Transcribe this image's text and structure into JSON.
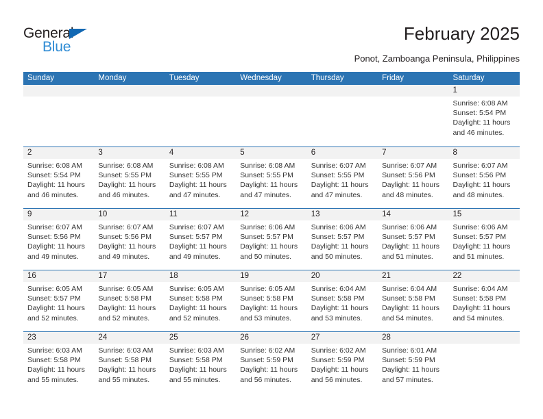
{
  "brand": {
    "name_top": "General",
    "name_bottom": "Blue",
    "accent_color": "#2e8bd4",
    "triangle_color": "#1268b3"
  },
  "header": {
    "title": "February 2025",
    "location": "Ponot, Zamboanga Peninsula, Philippines"
  },
  "theme": {
    "header_blue": "#2c74b3",
    "day_band_gray": "#f2f2f2",
    "text_color": "#231f20"
  },
  "weekdays": [
    "Sunday",
    "Monday",
    "Tuesday",
    "Wednesday",
    "Thursday",
    "Friday",
    "Saturday"
  ],
  "weeks": [
    [
      {
        "day": "",
        "sunrise": "",
        "sunset": "",
        "daylight_1": "",
        "daylight_2": ""
      },
      {
        "day": "",
        "sunrise": "",
        "sunset": "",
        "daylight_1": "",
        "daylight_2": ""
      },
      {
        "day": "",
        "sunrise": "",
        "sunset": "",
        "daylight_1": "",
        "daylight_2": ""
      },
      {
        "day": "",
        "sunrise": "",
        "sunset": "",
        "daylight_1": "",
        "daylight_2": ""
      },
      {
        "day": "",
        "sunrise": "",
        "sunset": "",
        "daylight_1": "",
        "daylight_2": ""
      },
      {
        "day": "",
        "sunrise": "",
        "sunset": "",
        "daylight_1": "",
        "daylight_2": ""
      },
      {
        "day": "1",
        "sunrise": "Sunrise: 6:08 AM",
        "sunset": "Sunset: 5:54 PM",
        "daylight_1": "Daylight: 11 hours",
        "daylight_2": "and 46 minutes."
      }
    ],
    [
      {
        "day": "2",
        "sunrise": "Sunrise: 6:08 AM",
        "sunset": "Sunset: 5:54 PM",
        "daylight_1": "Daylight: 11 hours",
        "daylight_2": "and 46 minutes."
      },
      {
        "day": "3",
        "sunrise": "Sunrise: 6:08 AM",
        "sunset": "Sunset: 5:55 PM",
        "daylight_1": "Daylight: 11 hours",
        "daylight_2": "and 46 minutes."
      },
      {
        "day": "4",
        "sunrise": "Sunrise: 6:08 AM",
        "sunset": "Sunset: 5:55 PM",
        "daylight_1": "Daylight: 11 hours",
        "daylight_2": "and 47 minutes."
      },
      {
        "day": "5",
        "sunrise": "Sunrise: 6:08 AM",
        "sunset": "Sunset: 5:55 PM",
        "daylight_1": "Daylight: 11 hours",
        "daylight_2": "and 47 minutes."
      },
      {
        "day": "6",
        "sunrise": "Sunrise: 6:07 AM",
        "sunset": "Sunset: 5:55 PM",
        "daylight_1": "Daylight: 11 hours",
        "daylight_2": "and 47 minutes."
      },
      {
        "day": "7",
        "sunrise": "Sunrise: 6:07 AM",
        "sunset": "Sunset: 5:56 PM",
        "daylight_1": "Daylight: 11 hours",
        "daylight_2": "and 48 minutes."
      },
      {
        "day": "8",
        "sunrise": "Sunrise: 6:07 AM",
        "sunset": "Sunset: 5:56 PM",
        "daylight_1": "Daylight: 11 hours",
        "daylight_2": "and 48 minutes."
      }
    ],
    [
      {
        "day": "9",
        "sunrise": "Sunrise: 6:07 AM",
        "sunset": "Sunset: 5:56 PM",
        "daylight_1": "Daylight: 11 hours",
        "daylight_2": "and 49 minutes."
      },
      {
        "day": "10",
        "sunrise": "Sunrise: 6:07 AM",
        "sunset": "Sunset: 5:56 PM",
        "daylight_1": "Daylight: 11 hours",
        "daylight_2": "and 49 minutes."
      },
      {
        "day": "11",
        "sunrise": "Sunrise: 6:07 AM",
        "sunset": "Sunset: 5:57 PM",
        "daylight_1": "Daylight: 11 hours",
        "daylight_2": "and 49 minutes."
      },
      {
        "day": "12",
        "sunrise": "Sunrise: 6:06 AM",
        "sunset": "Sunset: 5:57 PM",
        "daylight_1": "Daylight: 11 hours",
        "daylight_2": "and 50 minutes."
      },
      {
        "day": "13",
        "sunrise": "Sunrise: 6:06 AM",
        "sunset": "Sunset: 5:57 PM",
        "daylight_1": "Daylight: 11 hours",
        "daylight_2": "and 50 minutes."
      },
      {
        "day": "14",
        "sunrise": "Sunrise: 6:06 AM",
        "sunset": "Sunset: 5:57 PM",
        "daylight_1": "Daylight: 11 hours",
        "daylight_2": "and 51 minutes."
      },
      {
        "day": "15",
        "sunrise": "Sunrise: 6:06 AM",
        "sunset": "Sunset: 5:57 PM",
        "daylight_1": "Daylight: 11 hours",
        "daylight_2": "and 51 minutes."
      }
    ],
    [
      {
        "day": "16",
        "sunrise": "Sunrise: 6:05 AM",
        "sunset": "Sunset: 5:57 PM",
        "daylight_1": "Daylight: 11 hours",
        "daylight_2": "and 52 minutes."
      },
      {
        "day": "17",
        "sunrise": "Sunrise: 6:05 AM",
        "sunset": "Sunset: 5:58 PM",
        "daylight_1": "Daylight: 11 hours",
        "daylight_2": "and 52 minutes."
      },
      {
        "day": "18",
        "sunrise": "Sunrise: 6:05 AM",
        "sunset": "Sunset: 5:58 PM",
        "daylight_1": "Daylight: 11 hours",
        "daylight_2": "and 52 minutes."
      },
      {
        "day": "19",
        "sunrise": "Sunrise: 6:05 AM",
        "sunset": "Sunset: 5:58 PM",
        "daylight_1": "Daylight: 11 hours",
        "daylight_2": "and 53 minutes."
      },
      {
        "day": "20",
        "sunrise": "Sunrise: 6:04 AM",
        "sunset": "Sunset: 5:58 PM",
        "daylight_1": "Daylight: 11 hours",
        "daylight_2": "and 53 minutes."
      },
      {
        "day": "21",
        "sunrise": "Sunrise: 6:04 AM",
        "sunset": "Sunset: 5:58 PM",
        "daylight_1": "Daylight: 11 hours",
        "daylight_2": "and 54 minutes."
      },
      {
        "day": "22",
        "sunrise": "Sunrise: 6:04 AM",
        "sunset": "Sunset: 5:58 PM",
        "daylight_1": "Daylight: 11 hours",
        "daylight_2": "and 54 minutes."
      }
    ],
    [
      {
        "day": "23",
        "sunrise": "Sunrise: 6:03 AM",
        "sunset": "Sunset: 5:58 PM",
        "daylight_1": "Daylight: 11 hours",
        "daylight_2": "and 55 minutes."
      },
      {
        "day": "24",
        "sunrise": "Sunrise: 6:03 AM",
        "sunset": "Sunset: 5:58 PM",
        "daylight_1": "Daylight: 11 hours",
        "daylight_2": "and 55 minutes."
      },
      {
        "day": "25",
        "sunrise": "Sunrise: 6:03 AM",
        "sunset": "Sunset: 5:58 PM",
        "daylight_1": "Daylight: 11 hours",
        "daylight_2": "and 55 minutes."
      },
      {
        "day": "26",
        "sunrise": "Sunrise: 6:02 AM",
        "sunset": "Sunset: 5:59 PM",
        "daylight_1": "Daylight: 11 hours",
        "daylight_2": "and 56 minutes."
      },
      {
        "day": "27",
        "sunrise": "Sunrise: 6:02 AM",
        "sunset": "Sunset: 5:59 PM",
        "daylight_1": "Daylight: 11 hours",
        "daylight_2": "and 56 minutes."
      },
      {
        "day": "28",
        "sunrise": "Sunrise: 6:01 AM",
        "sunset": "Sunset: 5:59 PM",
        "daylight_1": "Daylight: 11 hours",
        "daylight_2": "and 57 minutes."
      },
      {
        "day": "",
        "sunrise": "",
        "sunset": "",
        "daylight_1": "",
        "daylight_2": ""
      }
    ]
  ]
}
